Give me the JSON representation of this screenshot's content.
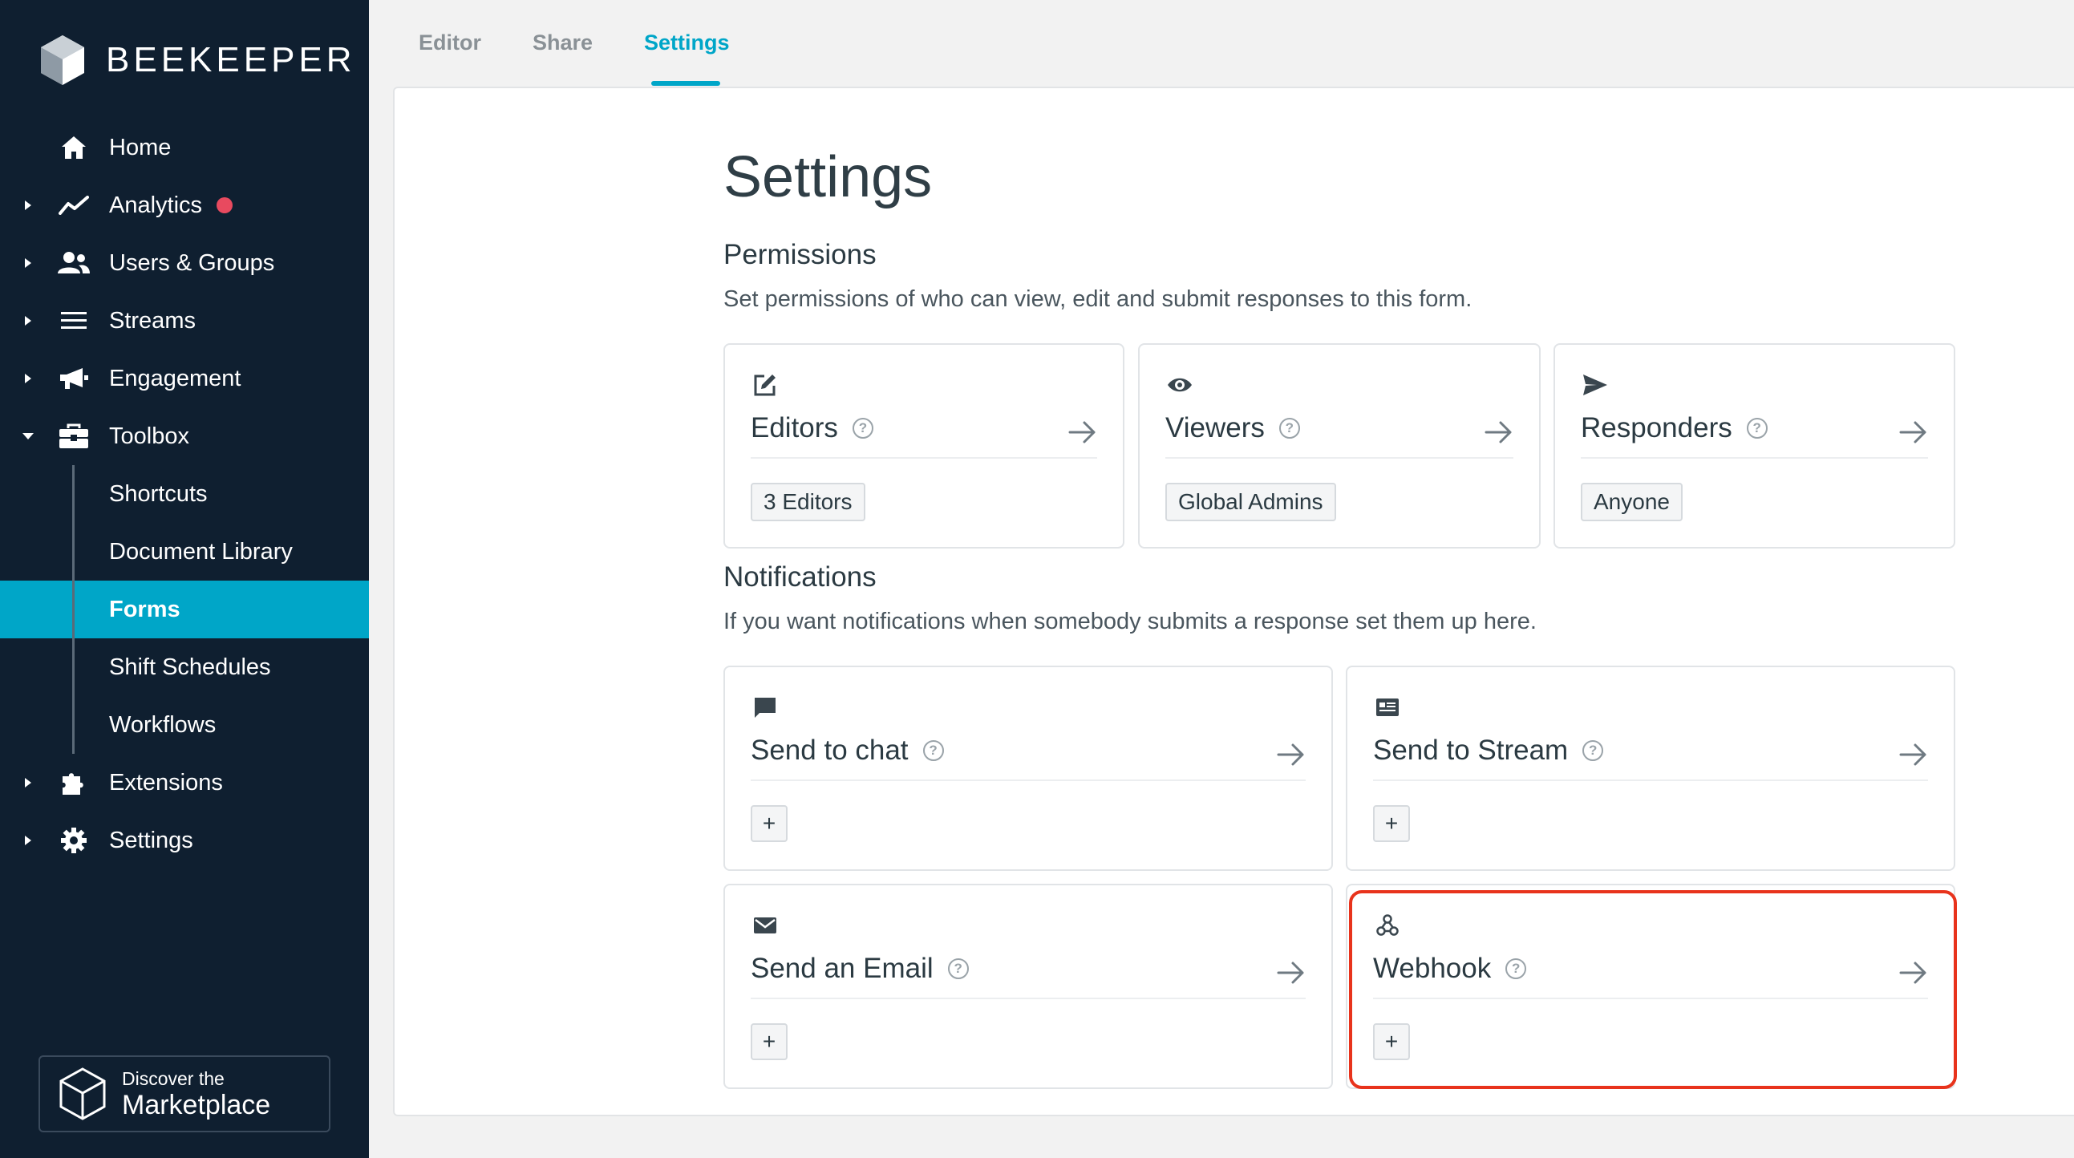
{
  "brand": {
    "name": "BEEKEEPER"
  },
  "sidebar": {
    "items": [
      {
        "label": "Home",
        "icon": "home-icon",
        "has_caret": false
      },
      {
        "label": "Analytics",
        "icon": "analytics-icon",
        "has_caret": true,
        "badge": true
      },
      {
        "label": "Users & Groups",
        "icon": "users-icon",
        "has_caret": true
      },
      {
        "label": "Streams",
        "icon": "streams-icon",
        "has_caret": true
      },
      {
        "label": "Engagement",
        "icon": "megaphone-icon",
        "has_caret": true
      },
      {
        "label": "Toolbox",
        "icon": "toolbox-icon",
        "has_caret": true,
        "expanded": true
      },
      {
        "label": "Shortcuts",
        "sub": true
      },
      {
        "label": "Document Library",
        "sub": true
      },
      {
        "label": "Forms",
        "sub": true,
        "active": true
      },
      {
        "label": "Shift Schedules",
        "sub": true
      },
      {
        "label": "Workflows",
        "sub": true
      },
      {
        "label": "Extensions",
        "icon": "puzzle-icon",
        "has_caret": true
      },
      {
        "label": "Settings",
        "icon": "gear-icon",
        "has_caret": true
      }
    ],
    "marketplace": {
      "small": "Discover the",
      "big": "Marketplace"
    }
  },
  "tabs": [
    {
      "label": "Editor"
    },
    {
      "label": "Share"
    },
    {
      "label": "Settings",
      "active": true
    }
  ],
  "page": {
    "title": "Settings",
    "permissions": {
      "heading": "Permissions",
      "description": "Set permissions of who can view, edit and submit responses to this form.",
      "cards": [
        {
          "title": "Editors",
          "value": "3 Editors",
          "icon": "edit-icon"
        },
        {
          "title": "Viewers",
          "value": "Global Admins",
          "icon": "eye-icon"
        },
        {
          "title": "Responders",
          "value": "Anyone",
          "icon": "send-icon"
        }
      ]
    },
    "notifications": {
      "heading": "Notifications",
      "description": "If you want notifications when somebody submits a response set them up here.",
      "cards": [
        {
          "title": "Send to chat",
          "icon": "chat-icon"
        },
        {
          "title": "Send to Stream",
          "icon": "stream-card-icon"
        },
        {
          "title": "Send an Email",
          "icon": "envelope-icon"
        },
        {
          "title": "Webhook",
          "icon": "webhook-icon"
        }
      ],
      "add_label": "+"
    }
  },
  "help_glyph": "?",
  "colors": {
    "sidebar_bg": "#0f1f30",
    "accent": "#00a6c8",
    "badge": "#e84a5f",
    "highlight": "#e8331c"
  }
}
